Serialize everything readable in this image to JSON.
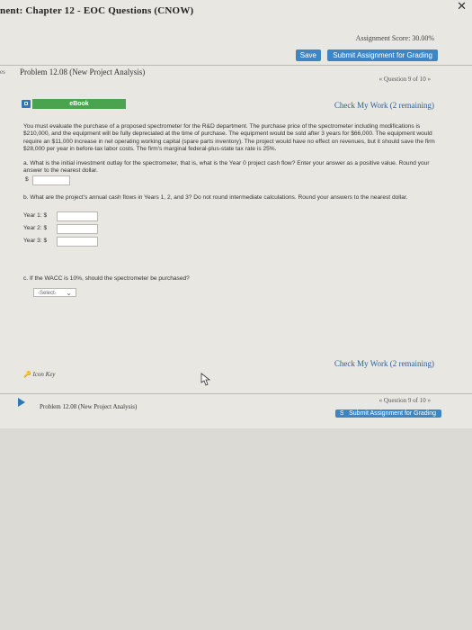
{
  "header": {
    "title": "nent: Chapter 12 - EOC Questions (CNOW)",
    "score": "Assignment Score: 30.00%",
    "save_label": "Save",
    "submit_label": "Submit Assignment for Grading"
  },
  "problem": {
    "left_tab": "es",
    "title": "Problem 12.08 (New Project Analysis)",
    "question_nav": "« Question 9 of 10 »",
    "ebook_label": "eBook",
    "check_work": "Check My Work (2 remaining)",
    "paragraph": "You must evaluate the purchase of a proposed spectrometer for the R&D department. The purchase price of the spectrometer including modifications is $210,000, and the equipment will be fully depreciated at the time of purchase. The equipment would be sold after 3 years for $66,000. The equipment would require an $11,000 increase in net operating working capital (spare parts inventory). The project would have no effect on revenues, but it should save the firm $28,000 per year in before-tax labor costs. The firm's marginal federal-plus-state tax rate is 25%.",
    "part_a": "a. What is the initial investment outlay for the spectrometer, that is, what is the Year 0 project cash flow? Enter your answer as a positive value. Round your answer to the nearest dollar.",
    "dollar": "$",
    "part_b": "b. What are the project's annual cash flows in Years 1, 2, and 3? Do not round intermediate calculations. Round your answers to the nearest dollar.",
    "years": [
      {
        "label": "Year 1: $"
      },
      {
        "label": "Year 2: $"
      },
      {
        "label": "Year 3: $"
      }
    ],
    "part_c": "c. If the WACC is 10%, should the spectrometer be purchased?",
    "select_value": "-Select-",
    "check_work_2": "Check My Work (2 remaining)",
    "icon_key": "Icon Key"
  },
  "footer": {
    "problem_title": "Problem 12.08 (New Project Analysis)",
    "question_nav": "« Question 9 of 10 »",
    "save_label": "Save",
    "submit_label": "Submit Assignment for Grading"
  }
}
